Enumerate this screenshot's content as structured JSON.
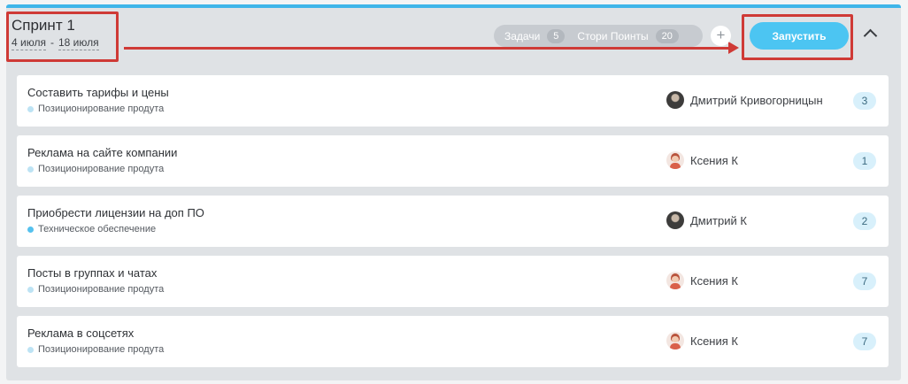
{
  "sprint": {
    "title": "Спринт 1",
    "date_start": "4 июля",
    "date_sep": "-",
    "date_end": "18 июля"
  },
  "stats": {
    "tasks_label": "Задачи",
    "tasks_count": "5",
    "points_label": "Стори Поинты",
    "points_count": "20"
  },
  "add_label": "+",
  "start_label": "Запустить",
  "colors": {
    "accent": "#4cc5f2",
    "annotation": "#cf3a36",
    "epic_positioning": "#bde3f4",
    "epic_technical": "#55c1ee"
  },
  "tasks": [
    {
      "name": "Составить тарифы и цены",
      "epic": "Позиционирование продута",
      "epic_color": "#bde3f4",
      "assignee": "Дмитрий Кривогорницын",
      "avatar": "dark",
      "points": "3"
    },
    {
      "name": "Реклама на сайте компании",
      "epic": "Позиционирование продута",
      "epic_color": "#bde3f4",
      "assignee": "Ксения К",
      "avatar": "female",
      "points": "1"
    },
    {
      "name": "Приобрести лицензии на доп ПО",
      "epic": "Техническое обеспечение",
      "epic_color": "#55c1ee",
      "assignee": "Дмитрий К",
      "avatar": "dark",
      "points": "2"
    },
    {
      "name": "Посты в группах и чатах",
      "epic": "Позиционирование продута",
      "epic_color": "#bde3f4",
      "assignee": "Ксения К",
      "avatar": "female",
      "points": "7"
    },
    {
      "name": "Реклама в соцсетях",
      "epic": "Позиционирование продута",
      "epic_color": "#bde3f4",
      "assignee": "Ксения К",
      "avatar": "female",
      "points": "7"
    }
  ]
}
